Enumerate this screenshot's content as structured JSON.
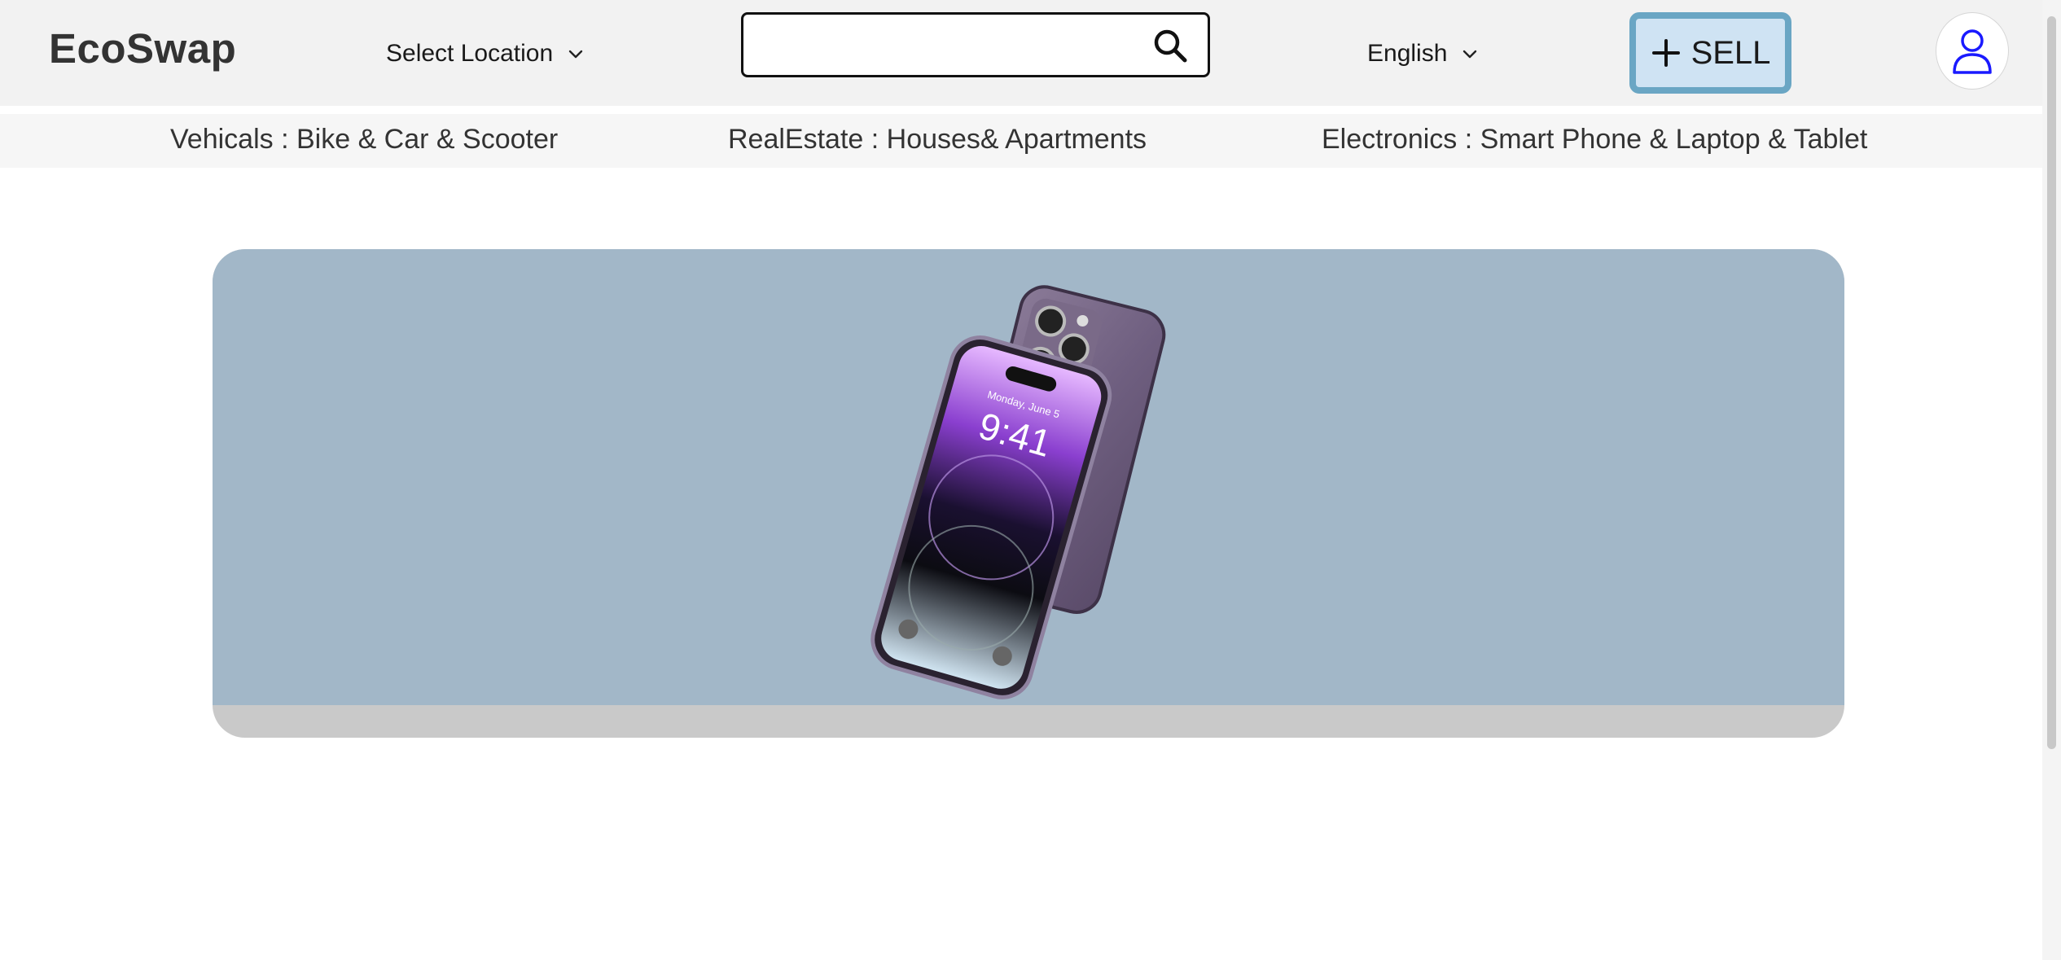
{
  "header": {
    "logo": "EcoSwap",
    "location_label": "Select Location",
    "search": {
      "value": "",
      "placeholder": ""
    },
    "language_label": "English",
    "sell_label": "SELL"
  },
  "categories": [
    "Vehicals : Bike & Car & Scooter",
    "RealEstate : Houses& Apartments",
    "Electronics : Smart Phone & Laptop & Tablet"
  ],
  "hero": {
    "phone_time": "9:41",
    "phone_date": "Monday, June 5"
  },
  "colors": {
    "header_bg": "#f2f2f2",
    "sell_bg": "#cfe3f3",
    "sell_border": "#6aa6c4",
    "hero_bg": "#a2b7c8",
    "avatar_icon": "#1a1aff"
  },
  "icons": [
    "chevron-down-icon",
    "search-icon",
    "plus-icon",
    "user-icon"
  ]
}
